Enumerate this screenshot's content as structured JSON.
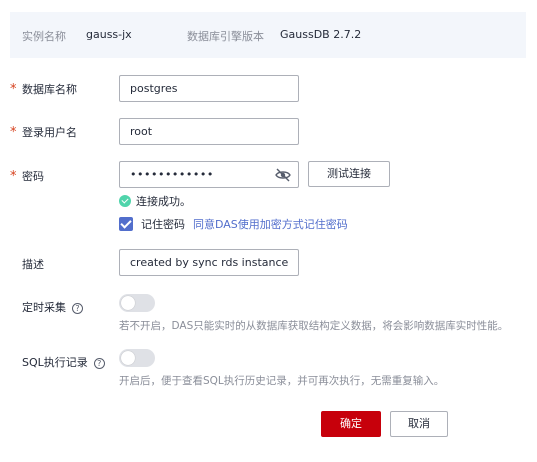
{
  "info": {
    "instance_label": "实例名称",
    "instance_value": "gauss-jx",
    "engine_label": "数据库引擎版本",
    "engine_value": "GaussDB 2.7.2"
  },
  "form": {
    "db_name": {
      "required_mark": "*",
      "label": "数据库名称",
      "value": "postgres"
    },
    "username": {
      "required_mark": "*",
      "label": "登录用户名",
      "value": "root"
    },
    "password": {
      "required_mark": "*",
      "label": "密码",
      "value": "••••••••••••",
      "test_button": "测试连接"
    },
    "connection_status": {
      "text": "连接成功。",
      "icon": "check-circle-icon",
      "color": "#50d4ab"
    },
    "remember": {
      "label": "记住密码",
      "checked": true,
      "link_text": "同意DAS使用加密方式记住密码"
    },
    "description": {
      "label": "描述",
      "value": "created by sync rds instance"
    },
    "scheduled_collect": {
      "label": "定时采集",
      "help": "?",
      "enabled": false,
      "hint": "若不开启，DAS只能实时的从数据库获取结构定义数据，将会影响数据库实时性能。"
    },
    "sql_record": {
      "label": "SQL执行记录",
      "help": "?",
      "enabled": false,
      "hint": "开启后，便于查看SQL执行历史记录，并可再次执行，无需重复输入。"
    }
  },
  "actions": {
    "ok": "确定",
    "cancel": "取消"
  },
  "colors": {
    "primary": "#c7000b",
    "link": "#526ecc",
    "required": "#d6411e"
  }
}
